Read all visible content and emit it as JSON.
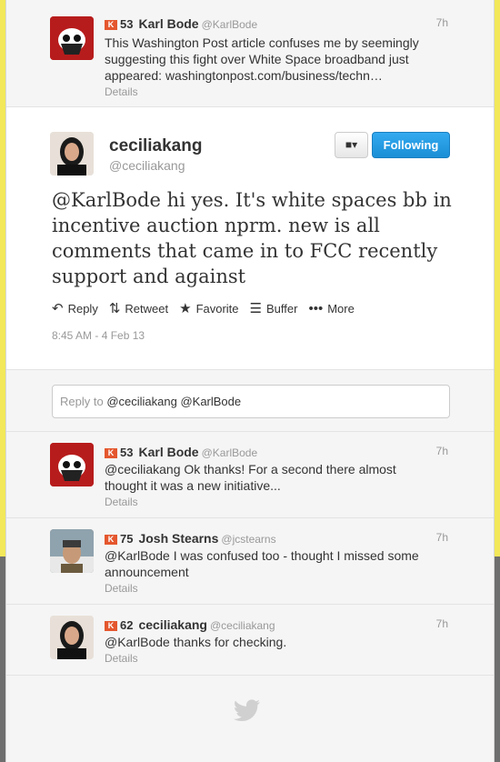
{
  "tweet1": {
    "klout_icon": "K",
    "klout_score": "53",
    "name": "Karl Bode",
    "handle": "@KarlBode",
    "time": "7h",
    "text": "This Washington Post article confuses me by seemingly suggesting this fight over White Space broadband just appeared: washingtonpost.com/business/techn…",
    "details": "Details"
  },
  "focus": {
    "name": "ceciliakang",
    "handle": "@ceciliakang",
    "text": "@KarlBode hi yes. It's white spaces bb in incentive auction nprm. new is all comments that came in to FCC recently support and against",
    "follow_label": "Following",
    "user_menu_icon": "person-dropdown-icon",
    "actions": {
      "reply": "Reply",
      "retweet": "Retweet",
      "favorite": "Favorite",
      "buffer": "Buffer",
      "more": "More"
    },
    "timestamp": "8:45 AM - 4 Feb 13"
  },
  "reply": {
    "prefix": "Reply to",
    "to": "@ceciliakang @KarlBode"
  },
  "replies": [
    {
      "klout_score": "53",
      "name": "Karl Bode",
      "handle": "@KarlBode",
      "time": "7h",
      "text": "@ceciliakang Ok thanks! For a second there almost thought it was a new initiative...",
      "details": "Details"
    },
    {
      "klout_score": "75",
      "name": "Josh Stearns",
      "handle": "@jcstearns",
      "time": "7h",
      "text": "@KarlBode I was confused too - thought I missed some announcement",
      "details": "Details"
    },
    {
      "klout_score": "62",
      "name": "ceciliakang",
      "handle": "@ceciliakang",
      "time": "7h",
      "text": "@KarlBode thanks for checking.",
      "details": "Details"
    }
  ],
  "colors": {
    "klout": "#e4572e",
    "follow_button": "#1b8fd6",
    "background_top": "#f2e85a",
    "background_bottom": "#6e6e6e"
  }
}
